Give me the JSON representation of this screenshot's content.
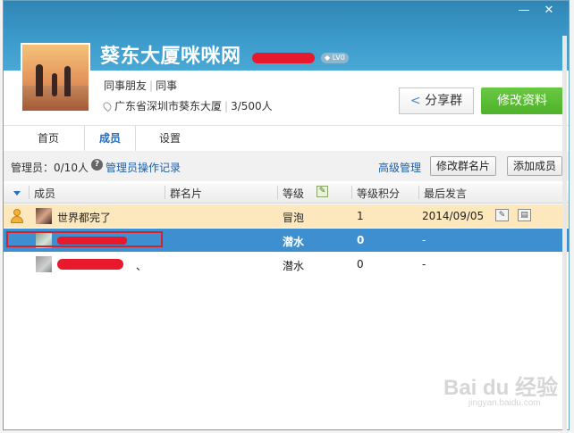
{
  "window": {
    "controls": [
      "—",
      "✕"
    ]
  },
  "group": {
    "name": "葵东大厦咪咪网",
    "level_badge": "LV0",
    "category": "同事朋友",
    "subcategory": "同事",
    "location": "广东省深圳市葵东大厦",
    "members": "3/500人"
  },
  "buttons": {
    "share": "分享群",
    "edit": "修改资料"
  },
  "tabs": [
    "首页",
    "成员",
    "设置"
  ],
  "toolbar": {
    "admin_count": "管理员：0/10人",
    "admin_log": "管理员操作记录",
    "advanced": "高级管理",
    "edit_card": "修改群名片",
    "add_member": "添加成员"
  },
  "table": {
    "headers": [
      "成员",
      "群名片",
      "等级",
      "等级积分",
      "最后发言"
    ],
    "rows": [
      {
        "name": "世界都完了",
        "card": "",
        "level": "冒泡",
        "points": "1",
        "last": "2014/09/05"
      },
      {
        "name": "",
        "card": "",
        "level": "潜水",
        "points": "0",
        "last": "-"
      },
      {
        "name": "、",
        "card": "",
        "level": "潜水",
        "points": "0",
        "last": "-"
      }
    ]
  },
  "watermark": {
    "brand": "Bai du 经验",
    "url": "jingyan.baidu.com"
  },
  "icons": [
    "share-icon",
    "location-pin-icon",
    "help-icon",
    "edit-level-icon",
    "owner-icon",
    "edit-card-icon",
    "profile-card-icon"
  ]
}
